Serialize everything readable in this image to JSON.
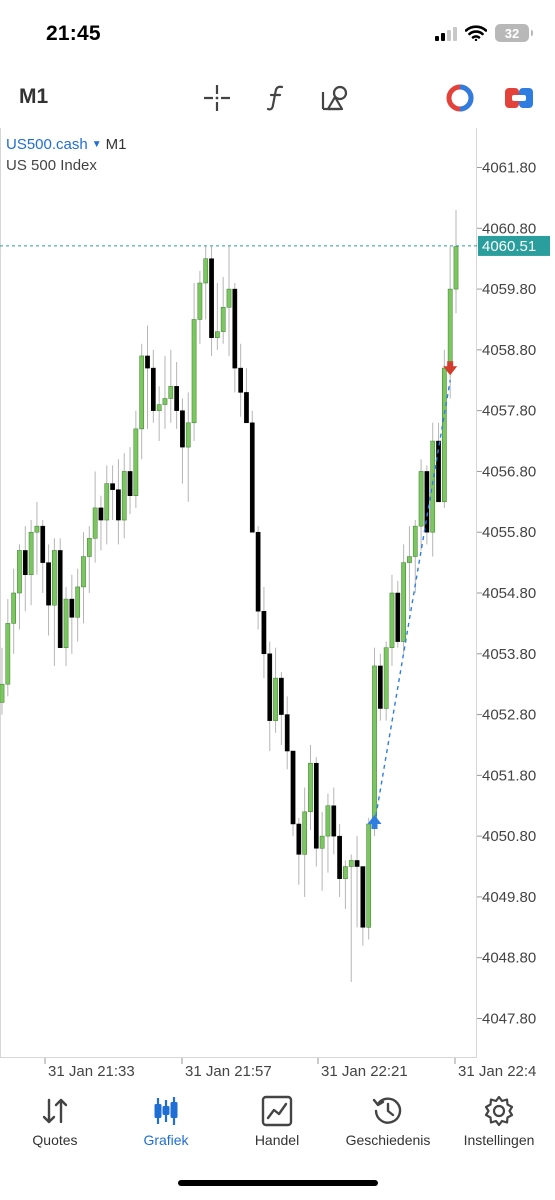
{
  "status": {
    "time": "21:45",
    "battery": "32"
  },
  "toolbar": {
    "timeframe": "M1",
    "tools": [
      "crosshair-icon",
      "indicator-f-icon",
      "objects-icon",
      "one-click-trading-icon",
      "trade-panel-icon"
    ]
  },
  "colors": {
    "bull": "#7bc661",
    "bear": "#000000",
    "accent": "#1f6ed4",
    "price_line": "#2a9d9d",
    "sell_arrow": "#d33b2c",
    "buy_arrow": "#2f7de1"
  },
  "chart_data": {
    "type": "candlestick",
    "symbol": "US500.cash",
    "timeframe": "M1",
    "description": "US 500 Index",
    "current_price": "4060.51",
    "y_ticks": [
      "4061.80",
      "4060.80",
      "4059.80",
      "4058.80",
      "4057.80",
      "4056.80",
      "4055.80",
      "4054.80",
      "4053.80",
      "4052.80",
      "4051.80",
      "4050.80",
      "4049.80",
      "4048.80",
      "4047.80"
    ],
    "x_ticks": [
      "31 Jan 21:33",
      "31 Jan 21:57",
      "31 Jan 22:21",
      "31 Jan 22:4"
    ],
    "ylim": [
      4047.15,
      4062.45
    ],
    "candles": [
      [
        4053.0,
        4053.9,
        4052.8,
        4053.3
      ],
      [
        4053.3,
        4054.7,
        4053.1,
        4054.3
      ],
      [
        4054.3,
        4055.2,
        4053.8,
        4054.8
      ],
      [
        4054.8,
        4055.6,
        4054.2,
        4055.5
      ],
      [
        4055.5,
        4055.9,
        4054.5,
        4055.1
      ],
      [
        4055.1,
        4056.0,
        4054.6,
        4055.8
      ],
      [
        4055.8,
        4056.3,
        4055.1,
        4055.9
      ],
      [
        4055.9,
        4056.0,
        4054.8,
        4055.3
      ],
      [
        4055.3,
        4055.6,
        4054.1,
        4054.6
      ],
      [
        4054.6,
        4055.7,
        4053.6,
        4055.5
      ],
      [
        4055.5,
        4055.7,
        4053.9,
        4053.9
      ],
      [
        4053.9,
        4054.9,
        4053.6,
        4054.7
      ],
      [
        4054.7,
        4055.1,
        4053.8,
        4054.4
      ],
      [
        4054.4,
        4055.2,
        4054.0,
        4054.9
      ],
      [
        4054.9,
        4055.8,
        4054.3,
        4055.4
      ],
      [
        4055.4,
        4055.9,
        4054.8,
        4055.7
      ],
      [
        4055.7,
        4056.8,
        4055.3,
        4056.2
      ],
      [
        4056.2,
        4056.4,
        4055.5,
        4056.0
      ],
      [
        4056.0,
        4056.9,
        4055.6,
        4056.6
      ],
      [
        4056.6,
        4056.9,
        4056.0,
        4056.5
      ],
      [
        4056.5,
        4057.0,
        4055.6,
        4056.0
      ],
      [
        4056.0,
        4057.1,
        4055.7,
        4056.8
      ],
      [
        4056.8,
        4057.2,
        4056.1,
        4056.4
      ],
      [
        4056.4,
        4057.8,
        4056.2,
        4057.5
      ],
      [
        4057.5,
        4058.9,
        4057.0,
        4058.7
      ],
      [
        4058.7,
        4059.2,
        4057.5,
        4058.5
      ],
      [
        4058.5,
        4058.8,
        4057.6,
        4057.8
      ],
      [
        4057.8,
        4058.2,
        4057.3,
        4057.9
      ],
      [
        4057.9,
        4058.7,
        4057.5,
        4058.0
      ],
      [
        4058.0,
        4058.8,
        4057.6,
        4058.2
      ],
      [
        4058.2,
        4058.6,
        4057.5,
        4057.8
      ],
      [
        4057.8,
        4058.0,
        4056.6,
        4057.2
      ],
      [
        4057.2,
        4058.1,
        4056.3,
        4057.6
      ],
      [
        4057.6,
        4059.9,
        4057.3,
        4059.3
      ],
      [
        4059.3,
        4060.1,
        4058.9,
        4059.9
      ],
      [
        4059.9,
        4060.5,
        4059.3,
        4060.3
      ],
      [
        4060.3,
        4060.5,
        4058.7,
        4059.0
      ],
      [
        4059.0,
        4059.9,
        4058.8,
        4059.1
      ],
      [
        4059.1,
        4060.0,
        4058.9,
        4059.5
      ],
      [
        4059.5,
        4060.5,
        4058.7,
        4059.8
      ],
      [
        4059.8,
        4059.9,
        4058.1,
        4058.5
      ],
      [
        4058.5,
        4058.9,
        4057.7,
        4058.1
      ],
      [
        4058.1,
        4058.5,
        4057.6,
        4057.6
      ],
      [
        4057.6,
        4057.8,
        4055.8,
        4055.8
      ],
      [
        4055.8,
        4055.9,
        4054.2,
        4054.5
      ],
      [
        4054.5,
        4054.9,
        4053.4,
        4053.8
      ],
      [
        4053.8,
        4054.0,
        4052.2,
        4052.7
      ],
      [
        4052.7,
        4053.9,
        4052.5,
        4053.4
      ],
      [
        4053.4,
        4053.5,
        4052.3,
        4052.8
      ],
      [
        4052.8,
        4053.1,
        4051.9,
        4052.2
      ],
      [
        4052.2,
        4052.2,
        4050.8,
        4051.0
      ],
      [
        4051.0,
        4051.1,
        4050.0,
        4050.5
      ],
      [
        4050.5,
        4051.6,
        4049.8,
        4051.2
      ],
      [
        4051.2,
        4052.3,
        4050.9,
        4052.0
      ],
      [
        4052.0,
        4052.1,
        4050.3,
        4050.6
      ],
      [
        4050.6,
        4051.2,
        4049.9,
        4050.8
      ],
      [
        4050.8,
        4051.5,
        4050.2,
        4051.3
      ],
      [
        4051.3,
        4051.6,
        4050.5,
        4050.8
      ],
      [
        4050.8,
        4051.0,
        4049.8,
        4050.1
      ],
      [
        4050.1,
        4050.4,
        4049.6,
        4050.3
      ],
      [
        4050.3,
        4050.5,
        4048.4,
        4050.4
      ],
      [
        4050.4,
        4050.8,
        4049.3,
        4050.3
      ],
      [
        4050.3,
        4050.3,
        4049.0,
        4049.3
      ],
      [
        4049.3,
        4051.1,
        4049.1,
        4051.0
      ],
      [
        4051.0,
        4053.9,
        4050.8,
        4053.6
      ],
      [
        4053.6,
        4053.8,
        4052.7,
        4052.9
      ],
      [
        4052.9,
        4054.0,
        4052.7,
        4053.9
      ],
      [
        4053.9,
        4055.1,
        4053.6,
        4054.8
      ],
      [
        4054.8,
        4055.0,
        4053.9,
        4054.0
      ],
      [
        4054.0,
        4055.6,
        4053.8,
        4055.3
      ],
      [
        4055.3,
        4055.9,
        4054.5,
        4055.4
      ],
      [
        4055.4,
        4056.0,
        4054.8,
        4055.9
      ],
      [
        4055.9,
        4057.0,
        4055.5,
        4056.8
      ],
      [
        4056.8,
        4056.9,
        4055.6,
        4055.8
      ],
      [
        4055.8,
        4057.6,
        4055.4,
        4057.3
      ],
      [
        4057.3,
        4057.6,
        4056.3,
        4056.3
      ],
      [
        4056.3,
        4058.8,
        4056.2,
        4058.5
      ],
      [
        4058.5,
        4060.5,
        4058.0,
        4059.8
      ],
      [
        4059.8,
        4061.1,
        4059.4,
        4060.5
      ]
    ]
  },
  "tabs": [
    {
      "label": "Quotes",
      "icon": "quotes-icon"
    },
    {
      "label": "Grafiek",
      "icon": "chart-icon"
    },
    {
      "label": "Handel",
      "icon": "trade-icon"
    },
    {
      "label": "Geschiedenis",
      "icon": "history-icon"
    },
    {
      "label": "Instellingen",
      "icon": "settings-icon"
    }
  ]
}
